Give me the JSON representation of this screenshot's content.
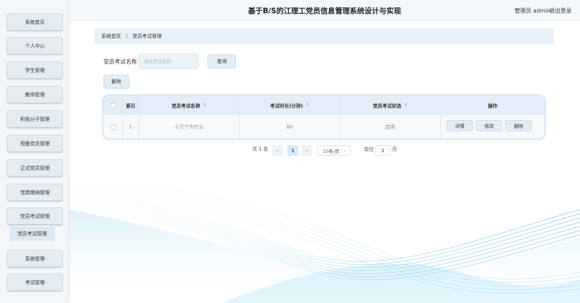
{
  "header": {
    "title": "基于B/S的江理工党员信息管理系统设计与实现",
    "admin_label": "管理员 admin",
    "logout_label": "退出登录"
  },
  "sidebar": {
    "items": [
      {
        "label": "系统首页"
      },
      {
        "label": "个人中心"
      },
      {
        "label": "学生管理"
      },
      {
        "label": "教师管理"
      },
      {
        "label": "积极分子管理"
      },
      {
        "label": "预备党员管理"
      },
      {
        "label": "正式党员管理"
      },
      {
        "label": "党费缴纳管理"
      },
      {
        "label": "党员考试管理"
      },
      {
        "label": "系统管理"
      },
      {
        "label": "考试管理"
      }
    ],
    "submenu_label": "党员考试管理"
  },
  "breadcrumb": {
    "home": "系统首页",
    "separator": "Ξ",
    "current": "党员考试管理"
  },
  "search": {
    "label": "党员考试名称",
    "placeholder": "党员考试名称",
    "query_button": "查询"
  },
  "toolbar": {
    "delete_button": "删除"
  },
  "table": {
    "columns": {
      "index": "索引",
      "name": "党员考试名称",
      "duration": "考试时长(分钟)",
      "status": "党员考试状态",
      "actions": "操作"
    },
    "sort_glyph": "⇕",
    "rows": [
      {
        "index": "1",
        "name": "十万个为什么",
        "duration": "60",
        "status": "启用",
        "actions": {
          "detail": "详情",
          "edit": "修改",
          "delete": "删除"
        }
      }
    ]
  },
  "pagination": {
    "total_text": "共 1 条",
    "prev": "<",
    "current_page": "1",
    "next": ">",
    "page_size": "10条/页",
    "goto_prefix": "前往",
    "goto_value": "1",
    "goto_suffix": "页"
  }
}
